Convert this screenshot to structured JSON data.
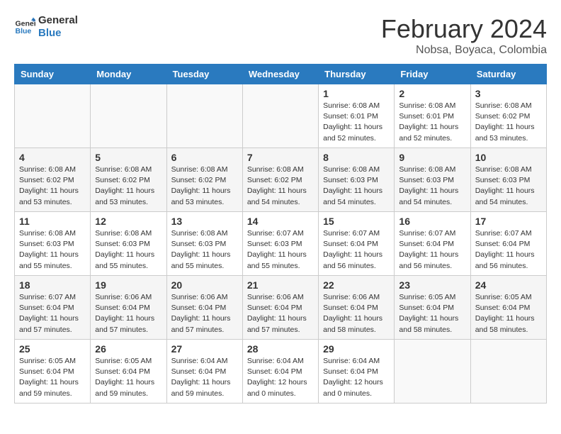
{
  "logo": {
    "line1": "General",
    "line2": "Blue"
  },
  "title": "February 2024",
  "location": "Nobsa, Boyaca, Colombia",
  "days_of_week": [
    "Sunday",
    "Monday",
    "Tuesday",
    "Wednesday",
    "Thursday",
    "Friday",
    "Saturday"
  ],
  "weeks": [
    [
      {
        "day": "",
        "info": ""
      },
      {
        "day": "",
        "info": ""
      },
      {
        "day": "",
        "info": ""
      },
      {
        "day": "",
        "info": ""
      },
      {
        "day": "1",
        "info": "Sunrise: 6:08 AM\nSunset: 6:01 PM\nDaylight: 11 hours\nand 52 minutes."
      },
      {
        "day": "2",
        "info": "Sunrise: 6:08 AM\nSunset: 6:01 PM\nDaylight: 11 hours\nand 52 minutes."
      },
      {
        "day": "3",
        "info": "Sunrise: 6:08 AM\nSunset: 6:02 PM\nDaylight: 11 hours\nand 53 minutes."
      }
    ],
    [
      {
        "day": "4",
        "info": "Sunrise: 6:08 AM\nSunset: 6:02 PM\nDaylight: 11 hours\nand 53 minutes."
      },
      {
        "day": "5",
        "info": "Sunrise: 6:08 AM\nSunset: 6:02 PM\nDaylight: 11 hours\nand 53 minutes."
      },
      {
        "day": "6",
        "info": "Sunrise: 6:08 AM\nSunset: 6:02 PM\nDaylight: 11 hours\nand 53 minutes."
      },
      {
        "day": "7",
        "info": "Sunrise: 6:08 AM\nSunset: 6:02 PM\nDaylight: 11 hours\nand 54 minutes."
      },
      {
        "day": "8",
        "info": "Sunrise: 6:08 AM\nSunset: 6:03 PM\nDaylight: 11 hours\nand 54 minutes."
      },
      {
        "day": "9",
        "info": "Sunrise: 6:08 AM\nSunset: 6:03 PM\nDaylight: 11 hours\nand 54 minutes."
      },
      {
        "day": "10",
        "info": "Sunrise: 6:08 AM\nSunset: 6:03 PM\nDaylight: 11 hours\nand 54 minutes."
      }
    ],
    [
      {
        "day": "11",
        "info": "Sunrise: 6:08 AM\nSunset: 6:03 PM\nDaylight: 11 hours\nand 55 minutes."
      },
      {
        "day": "12",
        "info": "Sunrise: 6:08 AM\nSunset: 6:03 PM\nDaylight: 11 hours\nand 55 minutes."
      },
      {
        "day": "13",
        "info": "Sunrise: 6:08 AM\nSunset: 6:03 PM\nDaylight: 11 hours\nand 55 minutes."
      },
      {
        "day": "14",
        "info": "Sunrise: 6:07 AM\nSunset: 6:03 PM\nDaylight: 11 hours\nand 55 minutes."
      },
      {
        "day": "15",
        "info": "Sunrise: 6:07 AM\nSunset: 6:04 PM\nDaylight: 11 hours\nand 56 minutes."
      },
      {
        "day": "16",
        "info": "Sunrise: 6:07 AM\nSunset: 6:04 PM\nDaylight: 11 hours\nand 56 minutes."
      },
      {
        "day": "17",
        "info": "Sunrise: 6:07 AM\nSunset: 6:04 PM\nDaylight: 11 hours\nand 56 minutes."
      }
    ],
    [
      {
        "day": "18",
        "info": "Sunrise: 6:07 AM\nSunset: 6:04 PM\nDaylight: 11 hours\nand 57 minutes."
      },
      {
        "day": "19",
        "info": "Sunrise: 6:06 AM\nSunset: 6:04 PM\nDaylight: 11 hours\nand 57 minutes."
      },
      {
        "day": "20",
        "info": "Sunrise: 6:06 AM\nSunset: 6:04 PM\nDaylight: 11 hours\nand 57 minutes."
      },
      {
        "day": "21",
        "info": "Sunrise: 6:06 AM\nSunset: 6:04 PM\nDaylight: 11 hours\nand 57 minutes."
      },
      {
        "day": "22",
        "info": "Sunrise: 6:06 AM\nSunset: 6:04 PM\nDaylight: 11 hours\nand 58 minutes."
      },
      {
        "day": "23",
        "info": "Sunrise: 6:05 AM\nSunset: 6:04 PM\nDaylight: 11 hours\nand 58 minutes."
      },
      {
        "day": "24",
        "info": "Sunrise: 6:05 AM\nSunset: 6:04 PM\nDaylight: 11 hours\nand 58 minutes."
      }
    ],
    [
      {
        "day": "25",
        "info": "Sunrise: 6:05 AM\nSunset: 6:04 PM\nDaylight: 11 hours\nand 59 minutes."
      },
      {
        "day": "26",
        "info": "Sunrise: 6:05 AM\nSunset: 6:04 PM\nDaylight: 11 hours\nand 59 minutes."
      },
      {
        "day": "27",
        "info": "Sunrise: 6:04 AM\nSunset: 6:04 PM\nDaylight: 11 hours\nand 59 minutes."
      },
      {
        "day": "28",
        "info": "Sunrise: 6:04 AM\nSunset: 6:04 PM\nDaylight: 12 hours\nand 0 minutes."
      },
      {
        "day": "29",
        "info": "Sunrise: 6:04 AM\nSunset: 6:04 PM\nDaylight: 12 hours\nand 0 minutes."
      },
      {
        "day": "",
        "info": ""
      },
      {
        "day": "",
        "info": ""
      }
    ]
  ]
}
